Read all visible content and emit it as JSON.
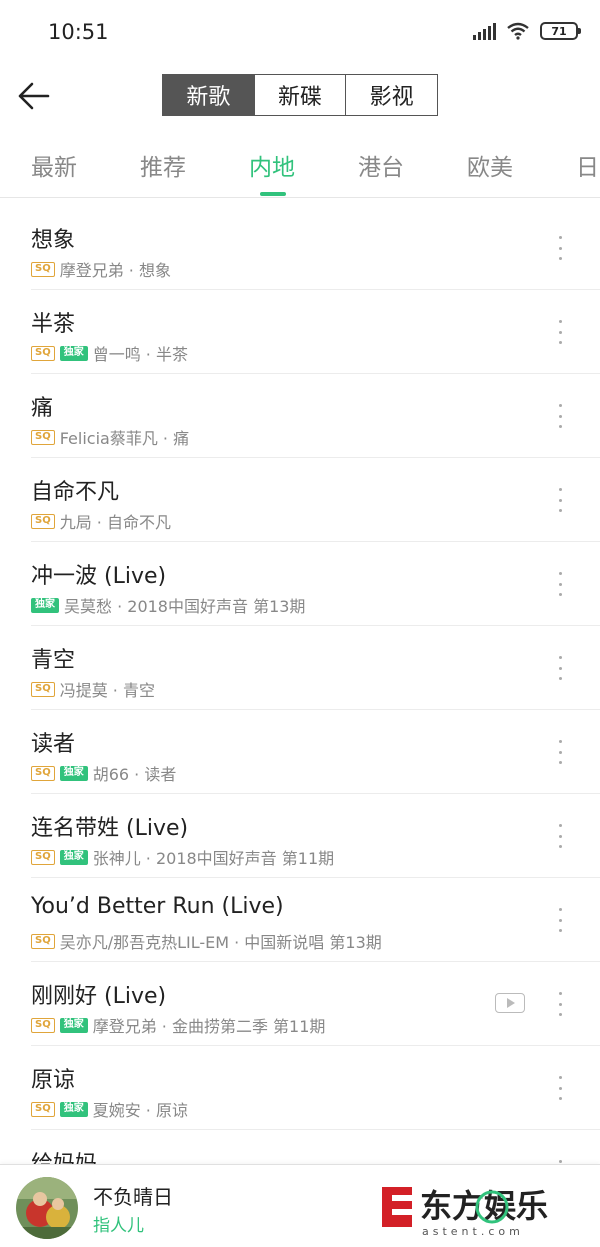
{
  "status": {
    "time": "10:51",
    "battery": "71"
  },
  "header": {
    "segments": [
      "新歌",
      "新碟",
      "影视"
    ],
    "active_segment": 0
  },
  "tabs": [
    "最新",
    "推荐",
    "内地",
    "港台",
    "欧美",
    "日"
  ],
  "active_tab": 2,
  "songs": [
    {
      "title": "想象",
      "meta": "摩登兄弟 · 想象",
      "sq": true,
      "exclusive": false,
      "mv": false
    },
    {
      "title": "半茶",
      "meta": "曾一鸣 · 半茶",
      "sq": true,
      "exclusive": true,
      "mv": false
    },
    {
      "title": "痛",
      "meta": "Felicia蔡菲凡 · 痛",
      "sq": true,
      "exclusive": false,
      "mv": false
    },
    {
      "title": "自命不凡",
      "meta": "九局 · 自命不凡",
      "sq": true,
      "exclusive": false,
      "mv": false
    },
    {
      "title": "冲一波 (Live)",
      "meta": "吴莫愁 · 2018中国好声音 第13期",
      "sq": false,
      "exclusive": true,
      "mv": false
    },
    {
      "title": "青空",
      "meta": "冯提莫 · 青空",
      "sq": true,
      "exclusive": false,
      "mv": false
    },
    {
      "title": "读者",
      "meta": "胡66 · 读者",
      "sq": true,
      "exclusive": true,
      "mv": false
    },
    {
      "title": "连名带姓 (Live)",
      "meta": "张神儿 · 2018中国好声音 第11期",
      "sq": true,
      "exclusive": true,
      "mv": false
    },
    {
      "title": "You’d Better Run (Live)",
      "meta": "吴亦凡/那吾克热LIL-EM · 中国新说唱 第13期",
      "sq": true,
      "exclusive": false,
      "mv": false
    },
    {
      "title": "刚刚好 (Live)",
      "meta": "摩登兄弟 · 金曲捞第二季 第11期",
      "sq": true,
      "exclusive": true,
      "mv": true
    },
    {
      "title": "原谅",
      "meta": "夏婉安 · 原谅",
      "sq": true,
      "exclusive": true,
      "mv": false
    },
    {
      "title": "给妈妈",
      "meta": "",
      "sq": false,
      "exclusive": false,
      "mv": false
    }
  ],
  "badges": {
    "sq": "SQ",
    "exclusive": "独家"
  },
  "player": {
    "title": "不负晴日",
    "artist": "指人儿"
  },
  "watermark": {
    "text": "东方娱乐",
    "sub": "astent.com"
  },
  "colors": {
    "accent": "#31c27c",
    "sq": "#e0a53a",
    "segment_active": "#555555"
  }
}
